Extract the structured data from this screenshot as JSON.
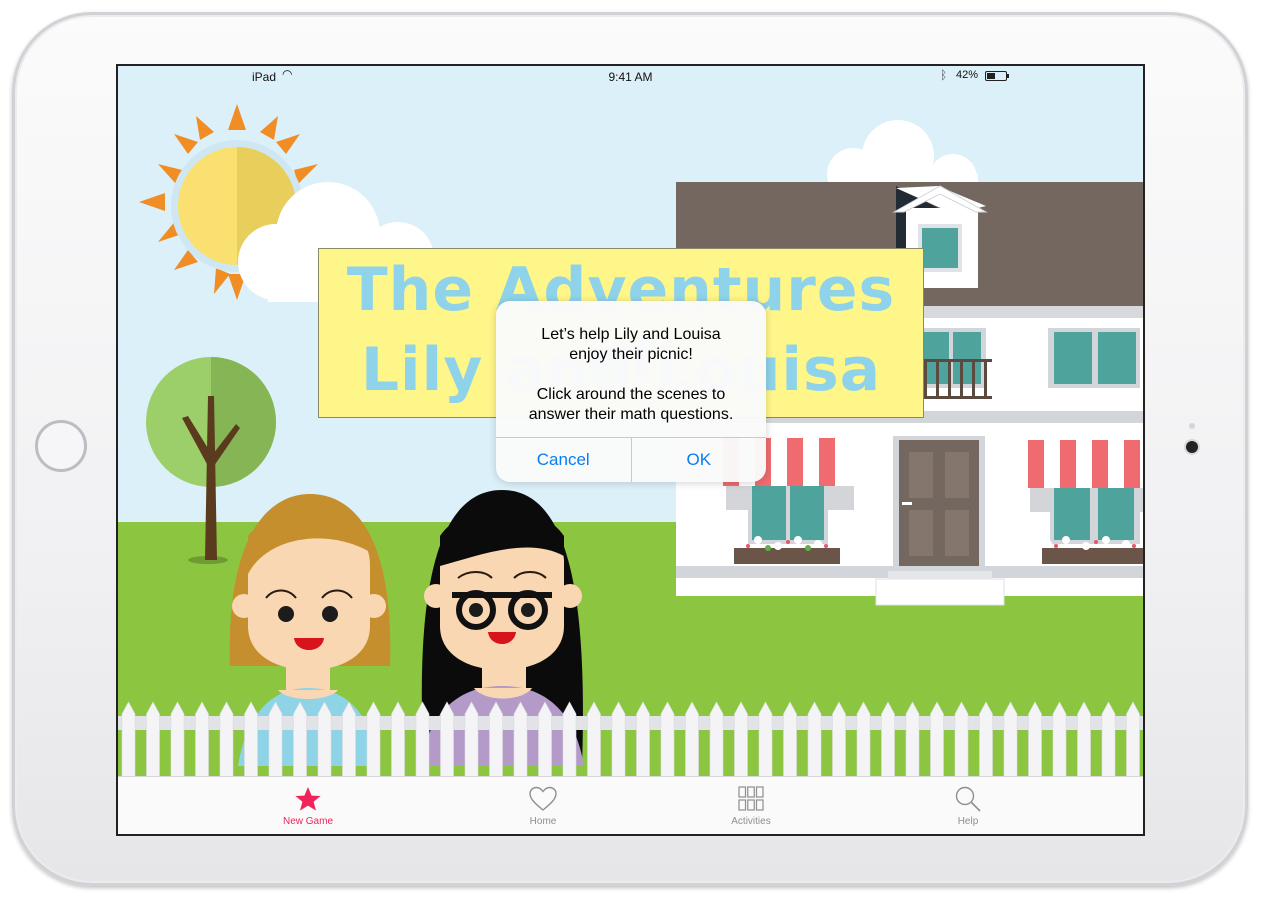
{
  "status_bar": {
    "carrier": "iPad",
    "time": "9:41 AM",
    "battery": "42%"
  },
  "banner": {
    "line1": "The Adventures of",
    "line2": "Lily and Louisa"
  },
  "alert": {
    "message": "Let’s help Lily and Louisa\nenjoy their picnic!\n\nClick around the scenes to\nanswer their math questions.",
    "cancel_label": "Cancel",
    "ok_label": "OK",
    "accent_color": "#0a7cf4"
  },
  "tab_bar": {
    "active_color": "#f0245a",
    "items": [
      {
        "label": "New Game",
        "icon": "star-icon"
      },
      {
        "label": "Home",
        "icon": "heart-icon"
      },
      {
        "label": "Activities",
        "icon": "grid-icon"
      },
      {
        "label": "Help",
        "icon": "magnifier-icon"
      }
    ]
  }
}
